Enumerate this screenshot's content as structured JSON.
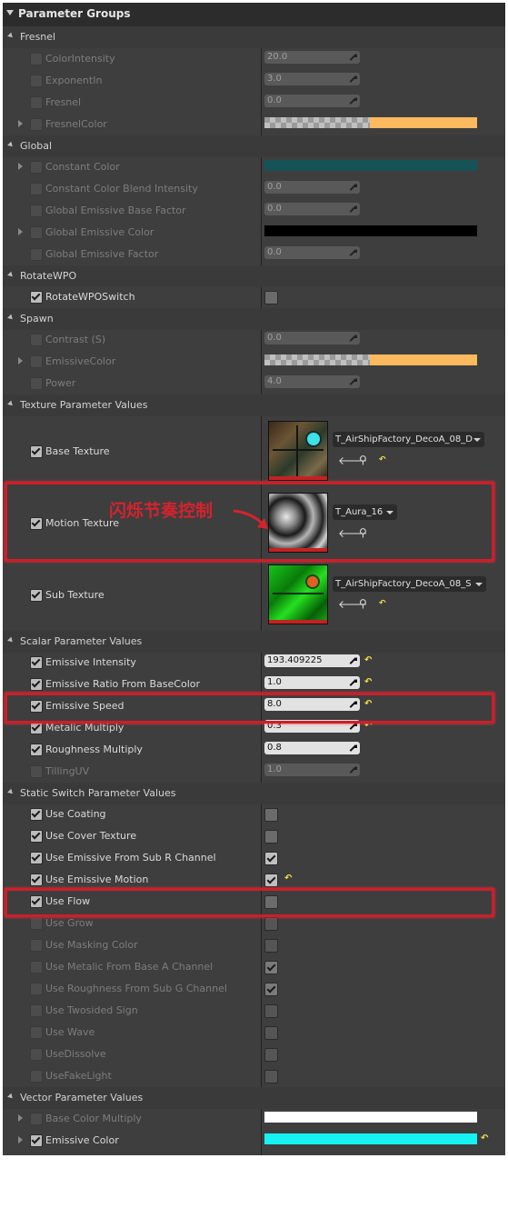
{
  "header": {
    "title": "Parameter Groups"
  },
  "fresnel": {
    "label": "Fresnel",
    "color_intensity": {
      "label": "ColorIntensity",
      "value": "20.0"
    },
    "exponent_in": {
      "label": "ExponentIn",
      "value": "3.0"
    },
    "fresnel": {
      "label": "Fresnel",
      "value": "0.0"
    },
    "fresnel_color": {
      "label": "FresnelColor",
      "color": "#fdb95d"
    }
  },
  "global": {
    "label": "Global",
    "constant_color": {
      "label": "Constant Color",
      "color": "#155357"
    },
    "constant_color_blend": {
      "label": "Constant Color Blend Intensity",
      "value": "0.0"
    },
    "emissive_base_factor": {
      "label": "Global Emissive Base Factor",
      "value": "0.0"
    },
    "emissive_color": {
      "label": "Global Emissive Color",
      "color": "#000000"
    },
    "emissive_factor": {
      "label": "Global Emissive Factor",
      "value": "0.0"
    }
  },
  "rotate_wpo": {
    "label": "RotateWPO",
    "switch": {
      "label": "RotateWPOSwitch",
      "checked": false
    }
  },
  "spawn": {
    "label": "Spawn",
    "contrast": {
      "label": "Contrast (S)",
      "value": "0.0"
    },
    "emissive_color": {
      "label": "EmissiveColor",
      "color": "#fdb95d"
    },
    "power": {
      "label": "Power",
      "value": "4.0"
    }
  },
  "texture": {
    "label": "Texture Parameter Values",
    "base": {
      "label": "Base Texture",
      "asset": "T_AirShipFactory_DecoA_08_D"
    },
    "motion": {
      "label": "Motion Texture",
      "asset": "T_Aura_16"
    },
    "sub": {
      "label": "Sub Texture",
      "asset": "T_AirShipFactory_DecoA_08_S"
    }
  },
  "annotation": {
    "text": "闪烁节奏控制",
    "color": "#d4232e"
  },
  "scalar": {
    "label": "Scalar Parameter Values",
    "emissive_intensity": {
      "label": "Emissive Intensity",
      "value": "193.409225"
    },
    "emissive_ratio": {
      "label": "Emissive Ratio From BaseColor",
      "value": "1.0"
    },
    "emissive_speed": {
      "label": "Emissive Speed",
      "value": "8.0"
    },
    "metalic_multiply": {
      "label": "Metalic Multiply",
      "value": "0.3"
    },
    "roughness_multiply": {
      "label": "Roughness Multiply",
      "value": "0.8"
    },
    "tilling_uv": {
      "label": "TillingUV",
      "value": "1.0"
    }
  },
  "static_switch": {
    "label": "Static Switch Parameter Values",
    "items": [
      {
        "label": "Use Coating",
        "enabled": true,
        "value": false,
        "reset": false
      },
      {
        "label": "Use Cover Texture",
        "enabled": true,
        "value": false,
        "reset": false
      },
      {
        "label": "Use Emissive From Sub R Channel",
        "enabled": true,
        "value": true,
        "reset": false
      },
      {
        "label": "Use Emissive Motion",
        "enabled": true,
        "value": true,
        "reset": true
      },
      {
        "label": "Use Flow",
        "enabled": true,
        "value": false,
        "reset": false
      },
      {
        "label": "Use Grow",
        "enabled": false,
        "value": false,
        "reset": false
      },
      {
        "label": "Use Masking Color",
        "enabled": false,
        "value": false,
        "reset": false
      },
      {
        "label": "Use Metalic From Base A Channel",
        "enabled": false,
        "value": true,
        "reset": false
      },
      {
        "label": "Use Roughness From Sub G Channel",
        "enabled": false,
        "value": true,
        "reset": false
      },
      {
        "label": "Use Twosided Sign",
        "enabled": false,
        "value": false,
        "reset": false
      },
      {
        "label": "Use Wave",
        "enabled": false,
        "value": false,
        "reset": false
      },
      {
        "label": "UseDissolve",
        "enabled": false,
        "value": false,
        "reset": false
      },
      {
        "label": "UseFakeLight",
        "enabled": false,
        "value": false,
        "reset": false
      }
    ]
  },
  "vector": {
    "label": "Vector Parameter Values",
    "base_color_multiply": {
      "label": "Base Color Multiply",
      "color": "#ffffff"
    },
    "emissive_color": {
      "label": "Emissive Color",
      "color": "#16f2f4"
    }
  },
  "colors": {
    "accent_highlight": "#cc1f2a",
    "reset_arrow": "#f2e14a",
    "panel_bg": "#3e3e3e"
  }
}
